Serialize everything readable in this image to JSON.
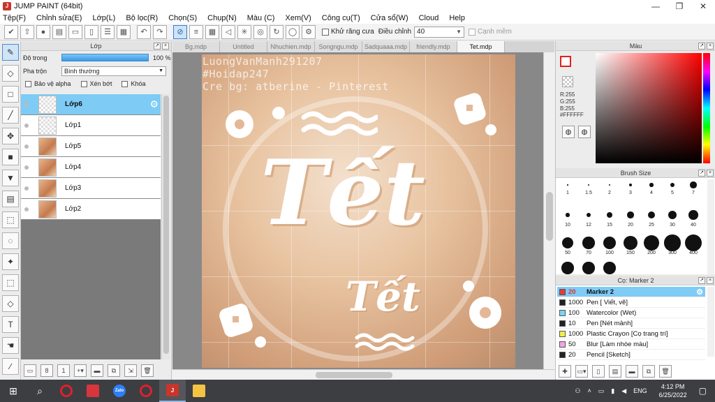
{
  "window": {
    "title": "JUMP PAINT (64bit)",
    "minimize": "—",
    "maximize": "❐",
    "close": "✕"
  },
  "menu": [
    "Tệp(F)",
    "Chỉnh sửa(E)",
    "Lớp(L)",
    "Bộ lọc(R)",
    "Chọn(S)",
    "Chụp(N)",
    "Màu (C)",
    "Xem(V)",
    "Công cụ(T)",
    "Cửa sổ(W)",
    "Cloud",
    "Help"
  ],
  "toolbar": {
    "antialias_label": "Khử răng cưa",
    "adjust_label": "Điều chỉnh",
    "adjust_value": "40",
    "edge_label": "Cạnh mềm"
  },
  "layer_panel": {
    "title": "Lớp",
    "opacity_label": "Độ trong",
    "opacity_value": "100 %",
    "opacity_fraction": 1.0,
    "blend_label": "Pha trộn",
    "blend_value": "Bình thường",
    "protect_alpha": "Bảo vệ alpha",
    "clipping": "Xén bớt",
    "lock": "Khóa",
    "layers": [
      {
        "name": "Lớp6",
        "selected": true,
        "thumb": "empty"
      },
      {
        "name": "Lớp1",
        "selected": false,
        "thumb": "empty"
      },
      {
        "name": "Lớp5",
        "selected": false,
        "thumb": "photo"
      },
      {
        "name": "Lớp4",
        "selected": false,
        "thumb": "photo"
      },
      {
        "name": "Lớp3",
        "selected": false,
        "thumb": "photo"
      },
      {
        "name": "Lớp2",
        "selected": false,
        "thumb": "photo"
      }
    ]
  },
  "tabs": [
    {
      "label": "Bg.mdp",
      "active": false
    },
    {
      "label": "Untitled",
      "active": false
    },
    {
      "label": "Nhuchien.mdp",
      "active": false
    },
    {
      "label": "Songngu.mdp",
      "active": false
    },
    {
      "label": "Sadquaaa.mdp",
      "active": false
    },
    {
      "label": "friendly.mdp",
      "active": false
    },
    {
      "label": "Tet.mdp",
      "active": true
    }
  ],
  "canvas": {
    "watermark_lines": [
      "LuongVanManh291207",
      "#Hoidap247",
      "Cre bg: atberine - Pinterest"
    ],
    "big_text": "Tết",
    "small_text": "Tết"
  },
  "color_panel": {
    "title": "Màu",
    "r": "R:255",
    "g": "G:255",
    "b": "B:255",
    "hex": "#FFFFFF",
    "primary_color": "#ffffff",
    "accent_border": "#e0201e"
  },
  "brush_panel": {
    "title": "Brush Size",
    "sizes": [
      "1",
      "1.5",
      "2",
      "3",
      "4",
      "5",
      "7",
      "10",
      "12",
      "15",
      "20",
      "25",
      "30",
      "40",
      "50",
      "70",
      "100",
      "150",
      "200",
      "300",
      "400",
      "",
      "",
      ""
    ]
  },
  "tool_panel": {
    "title": "Cọ: Marker 2",
    "tools": [
      {
        "size": "20",
        "name": "Marker 2",
        "color": "#e83a3a",
        "selected": true
      },
      {
        "size": "1000",
        "name": "Pen [ Viết, vẽ]",
        "color": "#222222",
        "selected": false
      },
      {
        "size": "100",
        "name": "Watercolor (Wet)",
        "color": "#7fd3f2",
        "selected": false
      },
      {
        "size": "10",
        "name": "Pen [Nét mảnh]",
        "color": "#222222",
        "selected": false
      },
      {
        "size": "1000",
        "name": "Plastic Crayon [Cọ trang trí]",
        "color": "#f3ec4a",
        "selected": false
      },
      {
        "size": "50",
        "name": "Blur [Làm nhòe màu]",
        "color": "#f0a6e0",
        "selected": false
      },
      {
        "size": "20",
        "name": "Pencil [Sketch]",
        "color": "#222222",
        "selected": false
      }
    ]
  },
  "taskbar": {
    "lang": "ENG",
    "time": "4:12 PM",
    "date": "6/25/2022"
  }
}
